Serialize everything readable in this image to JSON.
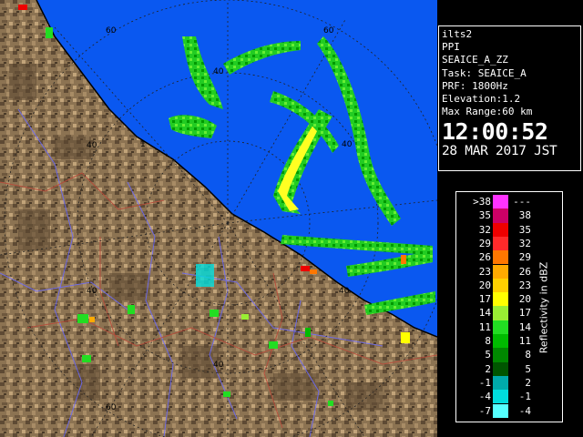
{
  "info": {
    "station": "ilts2",
    "mode": "PPI",
    "product": "SEAICE_A_ZZ",
    "task": "Task: SEAICE_A",
    "prf": "PRF: 1800Hz",
    "elevation": "Elevation:1.2",
    "max_range": "Max Range:60 km",
    "time": "12:00:52",
    "date": "28 MAR 2017 JST"
  },
  "legend": {
    "title": "Reflectivity in dBZ",
    "rows": [
      {
        "lo": ">38",
        "hi": "---",
        "color": "#ff33ff"
      },
      {
        "lo": "35",
        "hi": "38",
        "color": "#cc0066"
      },
      {
        "lo": "32",
        "hi": "35",
        "color": "#ee0000"
      },
      {
        "lo": "29",
        "hi": "32",
        "color": "#ff2a2a"
      },
      {
        "lo": "26",
        "hi": "29",
        "color": "#ff7700"
      },
      {
        "lo": "23",
        "hi": "26",
        "color": "#ffaa00"
      },
      {
        "lo": "20",
        "hi": "23",
        "color": "#ffd000"
      },
      {
        "lo": "17",
        "hi": "20",
        "color": "#ffff00"
      },
      {
        "lo": "14",
        "hi": "17",
        "color": "#99ee33"
      },
      {
        "lo": "11",
        "hi": "14",
        "color": "#22dd22"
      },
      {
        "lo": "8",
        "hi": "11",
        "color": "#00bb00"
      },
      {
        "lo": "5",
        "hi": "8",
        "color": "#008800"
      },
      {
        "lo": "2",
        "hi": "5",
        "color": "#005500"
      },
      {
        "lo": "-1",
        "hi": "2",
        "color": "#00aaaa"
      },
      {
        "lo": "-4",
        "hi": "-1",
        "color": "#00dddd"
      },
      {
        "lo": "-7",
        "hi": "-4",
        "color": "#55ffff"
      }
    ]
  },
  "range_labels": [
    {
      "text": "40"
    },
    {
      "text": "40"
    },
    {
      "text": "40"
    },
    {
      "text": "40"
    },
    {
      "text": "40"
    },
    {
      "text": "40"
    },
    {
      "text": "60"
    },
    {
      "text": "60"
    },
    {
      "text": "60"
    },
    {
      "text": "1"
    }
  ],
  "colors": {
    "sea": "#0a58f0",
    "land": "#8c7352",
    "land_dark": "#5e4a34",
    "echo_green": "#22dd22",
    "echo_yellow": "#ffff00"
  }
}
